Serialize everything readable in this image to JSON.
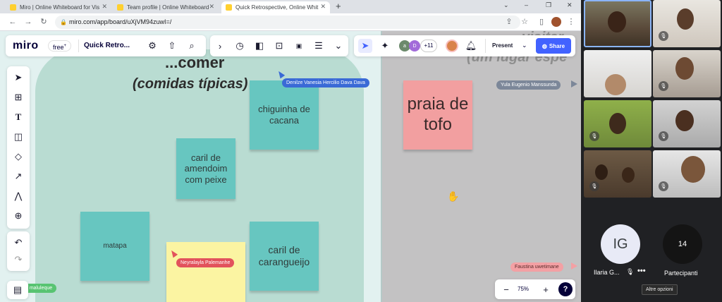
{
  "browser": {
    "tabs": [
      {
        "title": "Miro | Online Whiteboard for Vis"
      },
      {
        "title": "Team profile | Online Whiteboard"
      },
      {
        "title": "Quick Retrospective, Online Whit"
      }
    ],
    "new_tab": "+",
    "url": "miro.com/app/board/uXjVM94zuwI=/",
    "window_controls": [
      "⌄",
      "–",
      "❐",
      "✕"
    ]
  },
  "toolbar": {
    "logo": "miro",
    "plan": "free",
    "plan_mark": "+",
    "board_name": "Quick Retro...",
    "collab_count": "+11",
    "avatar_letters": [
      "a",
      "D"
    ],
    "present_label": "Present",
    "share_label": "Share",
    "zoom": "75%",
    "help": "?"
  },
  "board": {
    "heading_line1": "...comer",
    "heading_line2": "(comidas típicas)",
    "right_faded_line1": "visitar",
    "right_faded_line2": "(um lugar espe",
    "stickies": [
      {
        "text": "chiguinha de cacana",
        "color": "teal"
      },
      {
        "text": "caril de amendoim com peixe",
        "color": "teal"
      },
      {
        "text": "matapa",
        "color": "teal"
      },
      {
        "text": "",
        "color": "yellow"
      },
      {
        "text": "caril de carangueijo",
        "color": "teal"
      },
      {
        "text": "praia de tofo",
        "color": "pink"
      }
    ],
    "cursors": [
      {
        "name": "Denilze Vanesia Hercilio Dava Dava",
        "color": "#3a6ad6"
      },
      {
        "name": "Yula Eugenio Manssunda",
        "color": "#7c8799"
      },
      {
        "name": "Neyralayla Palemanhe",
        "color": "#e2525c"
      },
      {
        "name": "Faustina uwetimane",
        "color": "#f3a0a4"
      },
      {
        "name": "a maluleque",
        "color": "#58c472"
      }
    ]
  },
  "call": {
    "tile_initials": "IG",
    "tile_name": "Ilaria G...",
    "participants_count": "14",
    "participants_label": "Partecipanti",
    "tooltip": "Altre opzioni"
  },
  "colors": {
    "accent": "#4262ff",
    "teal_sticky": "#67c6c0",
    "pink_sticky": "#f29fa0",
    "yellow_sticky": "#fbf4a2"
  }
}
